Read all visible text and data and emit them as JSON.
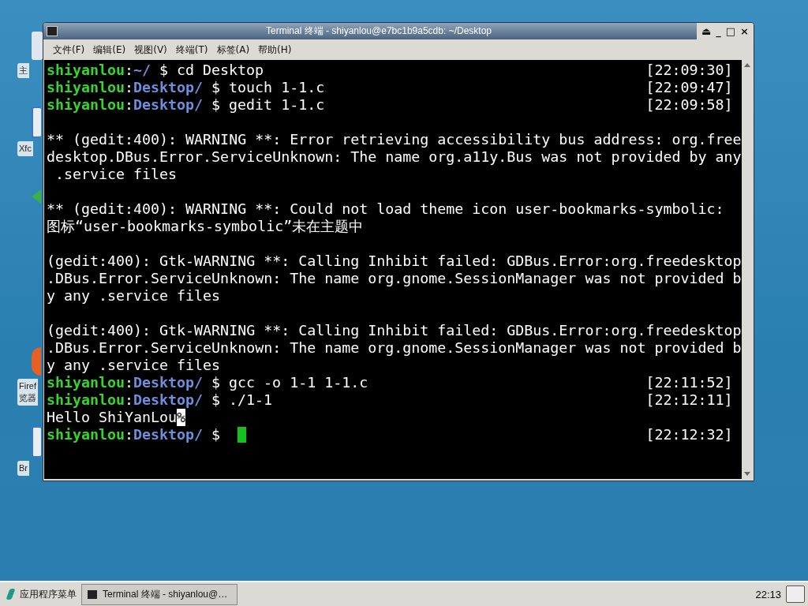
{
  "desktop_icons": [
    {
      "label": "主",
      "kind": "folder"
    },
    {
      "label": "Xfc",
      "kind": "app"
    },
    {
      "kind": "green"
    },
    {
      "label": "Firef\n览器",
      "kind": "firefox"
    },
    {
      "label": "Br",
      "kind": "app"
    }
  ],
  "window": {
    "title": "Terminal 终端 - shiyanlou@e7bc1b9a5cdb: ~/Desktop",
    "controls": [
      "⏏",
      "_",
      "□",
      "×"
    ]
  },
  "menu": [
    "文件(F)",
    "编辑(E)",
    "视图(V)",
    "终端(T)",
    "标签(A)",
    "帮助(H)"
  ],
  "terminal": {
    "lines": [
      {
        "kind": "prompt",
        "user": "shiyanlou",
        "separator": ":",
        "path": "~/",
        "symbol": "$",
        "command": "cd Desktop",
        "time": "[22:09:30]"
      },
      {
        "kind": "prompt",
        "user": "shiyanlou",
        "separator": ":",
        "path": "Desktop/",
        "symbol": "$",
        "command": "touch 1-1.c",
        "time": "[22:09:47]"
      },
      {
        "kind": "prompt",
        "user": "shiyanlou",
        "separator": ":",
        "path": "Desktop/",
        "symbol": "$",
        "command": "gedit 1-1.c",
        "time": "[22:09:58]"
      },
      {
        "kind": "blank"
      },
      {
        "kind": "output",
        "text": "** (gedit:400): WARNING **: Error retrieving accessibility bus address: org.free"
      },
      {
        "kind": "output",
        "text": "desktop.DBus.Error.ServiceUnknown: The name org.a11y.Bus was not provided by any"
      },
      {
        "kind": "output",
        "text": " .service files"
      },
      {
        "kind": "blank"
      },
      {
        "kind": "output",
        "text": "** (gedit:400): WARNING **: Could not load theme icon user-bookmarks-symbolic:"
      },
      {
        "kind": "output",
        "text": "图标“user-bookmarks-symbolic”未在主题中"
      },
      {
        "kind": "blank"
      },
      {
        "kind": "output",
        "text": "(gedit:400): Gtk-WARNING **: Calling Inhibit failed: GDBus.Error:org.freedesktop"
      },
      {
        "kind": "output",
        "text": ".DBus.Error.ServiceUnknown: The name org.gnome.SessionManager was not provided b"
      },
      {
        "kind": "output",
        "text": "y any .service files"
      },
      {
        "kind": "blank"
      },
      {
        "kind": "output",
        "text": "(gedit:400): Gtk-WARNING **: Calling Inhibit failed: GDBus.Error:org.freedesktop"
      },
      {
        "kind": "output",
        "text": ".DBus.Error.ServiceUnknown: The name org.gnome.SessionManager was not provided b"
      },
      {
        "kind": "output",
        "text": "y any .service files"
      },
      {
        "kind": "prompt",
        "user": "shiyanlou",
        "separator": ":",
        "path": "Desktop/",
        "symbol": "$",
        "command": "gcc -o 1-1 1-1.c",
        "time": "[22:11:52]"
      },
      {
        "kind": "prompt",
        "user": "shiyanlou",
        "separator": ":",
        "path": "Desktop/",
        "symbol": "$",
        "command": "./1-1",
        "time": "[22:12:11]"
      },
      {
        "kind": "output",
        "text": "Hello ShiYanLou",
        "end_mark": "%"
      },
      {
        "kind": "prompt",
        "user": "shiyanlou",
        "separator": ":",
        "path": "Desktop/",
        "symbol": "$",
        "time": "[22:12:32]",
        "cursor": true
      }
    ]
  },
  "taskbar": {
    "menu_label": "应用程序菜单",
    "tasks": [
      {
        "label": "Terminal 终端 - shiyanlou@…",
        "selected": true
      }
    ],
    "clock": "22:13"
  }
}
